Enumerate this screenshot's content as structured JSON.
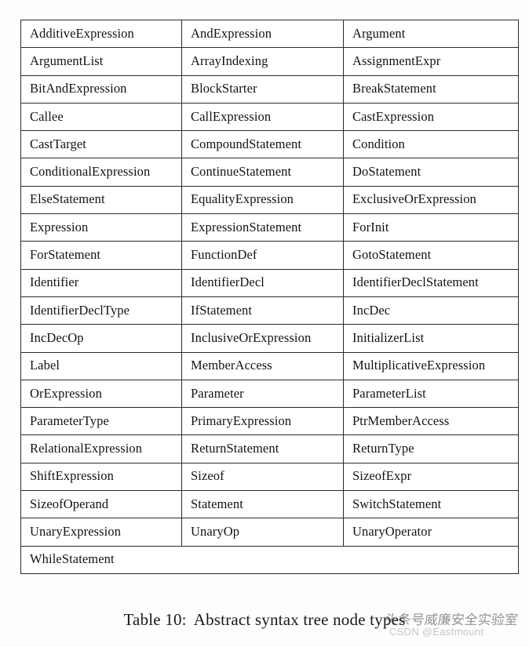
{
  "table": {
    "columns": 3,
    "rows": [
      [
        "AdditiveExpression",
        "AndExpression",
        "Argument"
      ],
      [
        "ArgumentList",
        "ArrayIndexing",
        "AssignmentExpr"
      ],
      [
        "BitAndExpression",
        "BlockStarter",
        "BreakStatement"
      ],
      [
        "Callee",
        "CallExpression",
        "CastExpression"
      ],
      [
        "CastTarget",
        "CompoundStatement",
        "Condition"
      ],
      [
        "ConditionalExpression",
        "ContinueStatement",
        "DoStatement"
      ],
      [
        "ElseStatement",
        "EqualityExpression",
        "ExclusiveOrExpression"
      ],
      [
        "Expression",
        "ExpressionStatement",
        "ForInit"
      ],
      [
        "ForStatement",
        "FunctionDef",
        "GotoStatement"
      ],
      [
        "Identifier",
        "IdentifierDecl",
        "IdentifierDeclStatement"
      ],
      [
        "IdentifierDeclType",
        "IfStatement",
        "IncDec"
      ],
      [
        "IncDecOp",
        "InclusiveOrExpression",
        "InitializerList"
      ],
      [
        "Label",
        "MemberAccess",
        "MultiplicativeExpression"
      ],
      [
        "OrExpression",
        "Parameter",
        "ParameterList"
      ],
      [
        "ParameterType",
        "PrimaryExpression",
        "PtrMemberAccess"
      ],
      [
        "RelationalExpression",
        "ReturnStatement",
        "ReturnType"
      ],
      [
        "ShiftExpression",
        "Sizeof",
        "SizeofExpr"
      ],
      [
        "SizeofOperand",
        "Statement",
        "SwitchStatement"
      ],
      [
        "UnaryExpression",
        "UnaryOp",
        "UnaryOperator"
      ]
    ],
    "last_row": {
      "value": "WhileStatement",
      "spans_full_width": true
    }
  },
  "caption": {
    "label": "Table 10:",
    "text": "Abstract syntax tree node types"
  },
  "watermark": {
    "chinese": "头条号威廉安全实验室",
    "latin": "CSDN @Eastmount"
  },
  "colors": {
    "page_background": "#fdfdfc",
    "table_background": "#ffffff",
    "border": "#2b2b2b",
    "text": "#131313",
    "caption_text": "#1a1a1a"
  }
}
